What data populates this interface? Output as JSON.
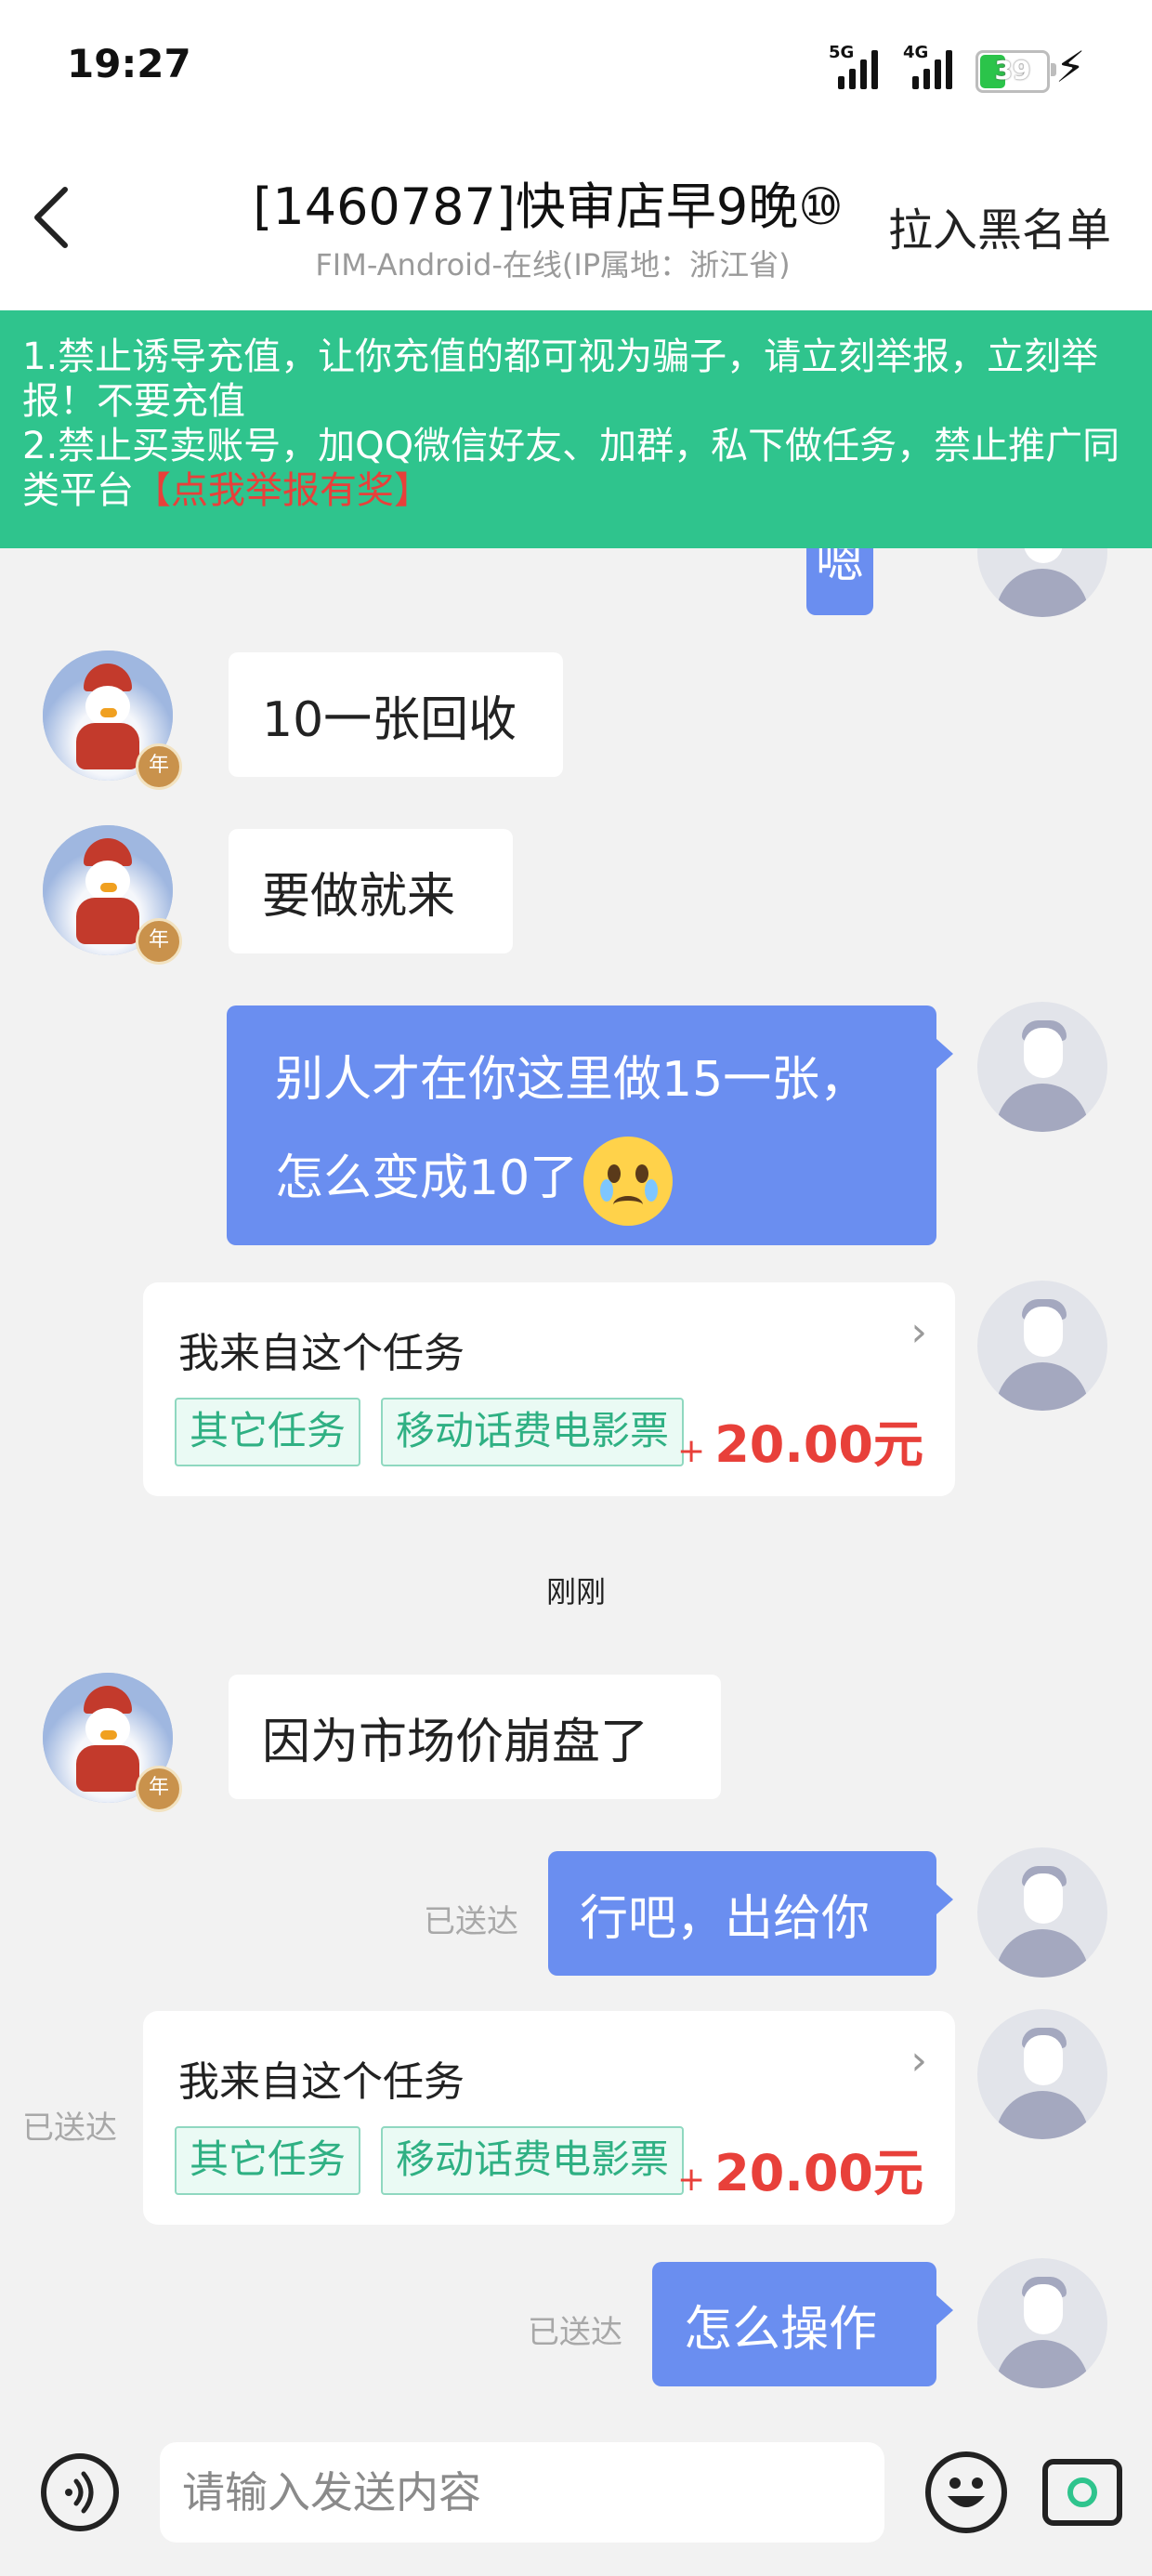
{
  "status_bar": {
    "time": "19:27",
    "signal_1_label": "5G",
    "signal_2_label": "4G",
    "battery_percent": "39",
    "battery_level": 0.39,
    "battery_color": "#2bc44a"
  },
  "header": {
    "title": "[1460787]快审店早9晚⑩",
    "subtitle": "FIM-Android-在线(IP属地：浙江省)",
    "blacklist_label": "拉入黑名单"
  },
  "notice": {
    "color": "#2fc48d",
    "line1": "1.禁止诱导充值，让你充值的都可视为骗子，请立刻举报，立刻举报！不要充值",
    "line2": "2.禁止买卖账号，加QQ微信好友、加群，私下做任务，禁止推广同类平台",
    "report_link": "【点我举报有奖】"
  },
  "badge_text": "年",
  "messages": [
    {
      "side": "right",
      "text": "嗯"
    },
    {
      "side": "left",
      "text": "10一张回收"
    },
    {
      "side": "left",
      "text": "要做就来"
    },
    {
      "side": "right",
      "text_line1": "别人才在你这里做15一张，",
      "text_line2": "怎么变成10了",
      "emoji": "crying-face"
    },
    {
      "side": "right",
      "card": {
        "title": "我来自这个任务",
        "tag1": "其它任务",
        "tag2": "移动话费电影票",
        "price_prefix": "+",
        "price": "20.00元"
      }
    },
    {
      "side": "left",
      "text": "因为市场价崩盘了"
    },
    {
      "side": "right",
      "text": "行吧，出给你",
      "status": "已送达"
    },
    {
      "side": "right",
      "card": {
        "title": "我来自这个任务",
        "tag1": "其它任务",
        "tag2": "移动话费电影票",
        "price_prefix": "+",
        "price": "20.00元"
      },
      "status": "已送达"
    },
    {
      "side": "right",
      "text": "怎么操作",
      "status": "已送达"
    }
  ],
  "timestamp": "刚刚",
  "input": {
    "placeholder": "请输入发送内容"
  },
  "colors": {
    "bubble_right": "#6a8ef0",
    "price": "#e8403a",
    "tag": "#2fb083"
  }
}
